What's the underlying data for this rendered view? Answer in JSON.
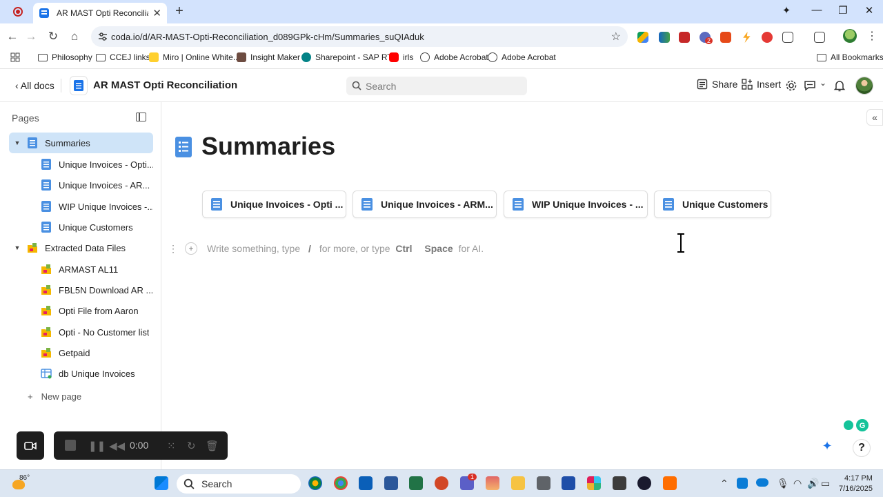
{
  "browser": {
    "tab_title": "AR MAST Opti Reconciliation · S",
    "url": "coda.io/d/AR-MAST-Opti-Reconciliation_d089GPk-cHm/Summaries_suQIAduk",
    "bookmarks": [
      "Philosophy",
      "CCEJ links",
      "Miro | Online White...",
      "Insight Maker",
      "Sharepoint - SAP RTR",
      "irls",
      "Adobe Acrobat",
      "Adobe Acrobat"
    ],
    "all_bookmarks": "All Bookmarks",
    "extension_badge": "2"
  },
  "header": {
    "all_docs": "All docs",
    "doc_title": "AR MAST Opti Reconciliation",
    "search_placeholder": "Search",
    "share": "Share",
    "insert": "Insert",
    "chevron": "⌄"
  },
  "sidebar": {
    "pages_label": "Pages",
    "items": [
      {
        "label": "Summaries",
        "level": 0,
        "expanded": true,
        "active": true,
        "icon": "doc-page-icon"
      },
      {
        "label": "Unique Invoices - Opti...",
        "level": 1,
        "icon": "doc-page-icon"
      },
      {
        "label": "Unique Invoices - AR...",
        "level": 1,
        "icon": "doc-page-icon"
      },
      {
        "label": "WIP Unique Invoices -...",
        "level": 1,
        "icon": "doc-page-icon"
      },
      {
        "label": "Unique Customers",
        "level": 1,
        "icon": "doc-page-icon"
      },
      {
        "label": "Extracted Data Files",
        "level": 0,
        "expanded": true,
        "icon": "data-file-icon"
      },
      {
        "label": "ARMAST AL11",
        "level": 1,
        "icon": "data-file-icon"
      },
      {
        "label": "FBL5N Download AR ...",
        "level": 1,
        "icon": "data-file-icon"
      },
      {
        "label": "Opti File from Aaron",
        "level": 1,
        "icon": "data-file-icon"
      },
      {
        "label": "Opti - No Customer list",
        "level": 1,
        "icon": "data-file-icon"
      },
      {
        "label": "Getpaid",
        "level": 1,
        "icon": "data-file-icon"
      },
      {
        "label": "db Unique Invoices",
        "level": 1,
        "icon": "table-icon"
      }
    ],
    "new_page": "New page"
  },
  "main": {
    "page_title": "Summaries",
    "cards": [
      {
        "label": "Unique Invoices - Opti ..."
      },
      {
        "label": "Unique Invoices - ARM..."
      },
      {
        "label": "WIP Unique Invoices - ..."
      },
      {
        "label": "Unique Customers"
      }
    ],
    "placeholder": {
      "part1": "Write something, type",
      "slash": "/",
      "part2": "for more, or type",
      "key1": "Ctrl",
      "key2": "Space",
      "part3": "for AI."
    }
  },
  "recorder": {
    "time": "0:00"
  },
  "taskbar": {
    "weather": "86°",
    "search": "Search",
    "teams_badge": "1",
    "time": "4:17 PM",
    "date": "7/16/2025"
  },
  "colors": {
    "tab_bar": "#d3e3fd",
    "active_nav": "#cfe4f8",
    "accent_blue": "#1a73e8"
  }
}
